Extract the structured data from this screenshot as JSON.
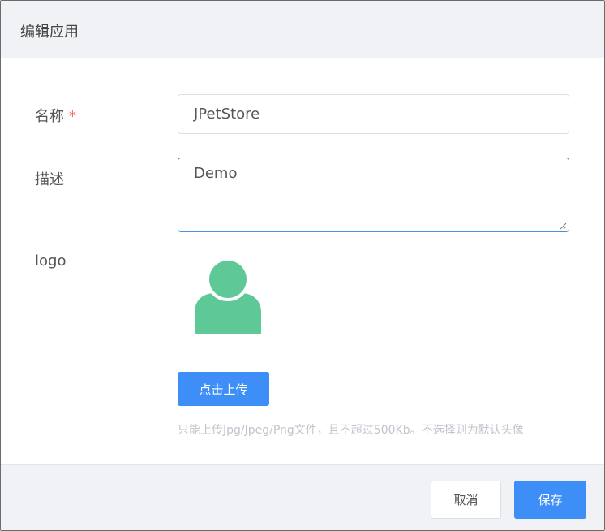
{
  "dialog": {
    "title": "编辑应用"
  },
  "form": {
    "name": {
      "label": "名称",
      "required_mark": "*",
      "value": "JPetStore"
    },
    "description": {
      "label": "描述",
      "value": "Demo"
    },
    "logo": {
      "label": "logo",
      "image_icon": "user-avatar-icon",
      "upload_button": "点击上传",
      "hint": "只能上传Jpg/Jpeg/Png文件，且不超过500Kb。不选择则为默认头像"
    }
  },
  "footer": {
    "cancel_label": "取消",
    "save_label": "保存"
  },
  "colors": {
    "accent": "#3e8ef7",
    "avatar": "#5ec896",
    "required": "#f56c6c",
    "header_bg": "#f1f2f5"
  }
}
